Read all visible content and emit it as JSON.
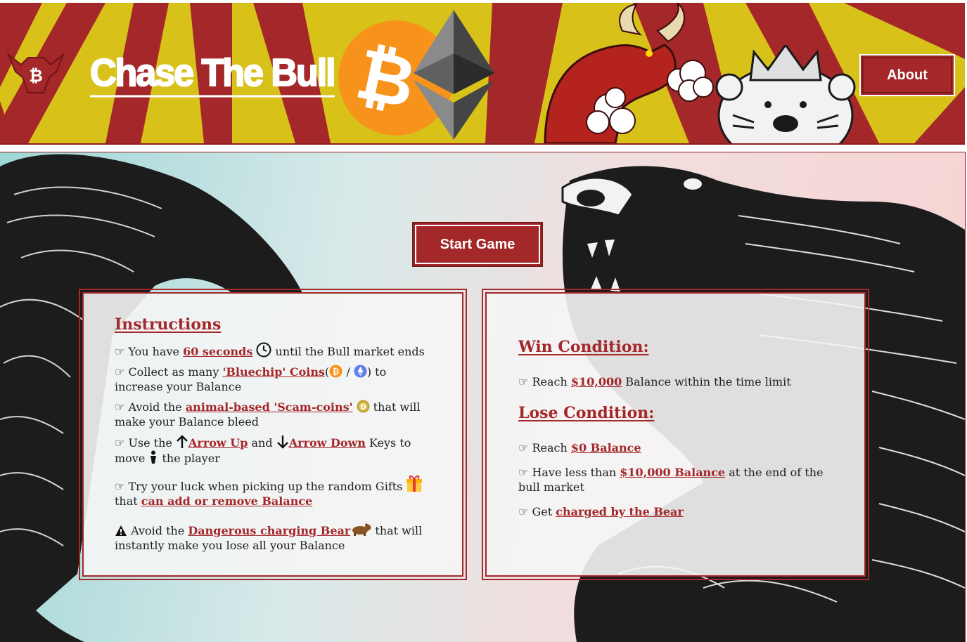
{
  "header": {
    "brand_title": "Chase The Bull",
    "about_label": "About",
    "logo_icon": "bull-bitcoin-logo-icon",
    "colors": {
      "red": "#a4272a",
      "yellow": "#d8c21a",
      "btc_orange": "#f7931a"
    }
  },
  "main": {
    "start_label": "Start Game"
  },
  "instructions": {
    "title": "Instructions",
    "items": [
      {
        "pre": "You have ",
        "hl": "60 seconds",
        "post": " until the Bull market ends"
      },
      {
        "pre": "Collect as many ",
        "hl": "'Bluechip' Coins",
        "mid": "(",
        "sep": " / ",
        "post": ") to increase your Balance"
      },
      {
        "pre": "Avoid the ",
        "hl": "animal-based 'Scam-coins'",
        "post": " that will make your Balance bleed"
      },
      {
        "pre": "Use the ",
        "hl": "Arrow Up",
        "mid": " and ",
        "hl2": "Arrow Down",
        "post": " Keys to move ",
        "post2": " the player"
      },
      {
        "pre": "Try your luck when picking up the random Gifts ",
        "post": " that ",
        "hl": "can add or remove Balance"
      },
      {
        "pre": "Avoid the ",
        "hl": "Dangerous charging Bear",
        "post": " that will instantly make you lose all your Balance"
      }
    ]
  },
  "conditions": {
    "win_title": "Win Condition:",
    "win_items": [
      {
        "pre": "Reach ",
        "hl": "$10,000",
        "post": " Balance within the time limit"
      }
    ],
    "lose_title": "Lose Condition:",
    "lose_items": [
      {
        "pre": "Reach ",
        "hl": "$0 Balance",
        "post": ""
      },
      {
        "pre": "Have less than ",
        "hl": "$10,000 Balance",
        "post": " at the end of the bull market"
      },
      {
        "pre": "Get ",
        "hl": "charged by the Bear",
        "post": ""
      }
    ]
  }
}
